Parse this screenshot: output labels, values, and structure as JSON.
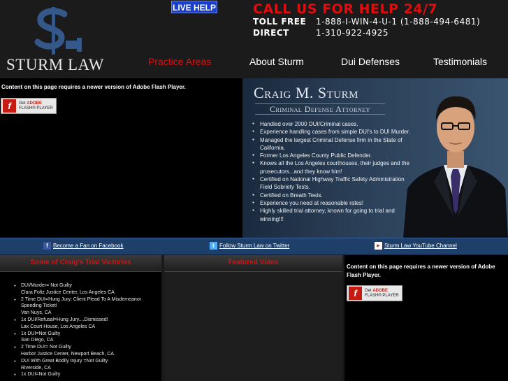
{
  "header": {
    "logo_text": "STURM LAW",
    "live_help": "LIVE HELP",
    "call_us": "CALL US FOR HELP 24/7",
    "toll_free_label": "TOLL FREE",
    "toll_free_number": "1-888-I-WIN-4-U-1 (1-888-494-6481)",
    "direct_label": "DIRECT",
    "direct_number": "1-310-922-4925"
  },
  "nav": {
    "items": [
      {
        "label": "Practice Areas",
        "active": true
      },
      {
        "label": "About Sturm",
        "active": false
      },
      {
        "label": "Dui Defenses",
        "active": false
      },
      {
        "label": "Testimonials",
        "active": false
      }
    ]
  },
  "hero": {
    "flash_message": "Content on this page requires a newer version of Adobe Flash Player.",
    "flash_badge": {
      "line1": "Get ",
      "brand": "ADOBE",
      "line2": "FLASH® PLAYER",
      "glyph": "f"
    },
    "name": "Craig M. Sturm",
    "title": "Criminal Defense Attorney",
    "bullets": [
      "Handled over 2000 DUI/Criminal cases.",
      "Experience handling cases from simple DUI's to DUI Murder.",
      "Managed the largest Criminal Defense firm in the State of California.",
      "Former Los Angeles County Public Defender.",
      "Knows all the Los Angeles courthouses, their judges and the prosecutors...and they know him!",
      "Certified on National Highway Traffic Safety Administration Field Sobriety Tests.",
      "Certified on Breath Tests.",
      "Experience you need at reasonable rates!",
      "Highly skilled trial attorney, known for going to trial and winning!!!"
    ]
  },
  "social": {
    "facebook": {
      "icon": "facebook-icon",
      "label": "Become a Fan on Facebook"
    },
    "twitter": {
      "icon": "twitter-icon",
      "label": "Follow Sturm Law on Twitter"
    },
    "youtube": {
      "icon": "youtube-icon",
      "label": "Sturm Law YouTube Channel"
    }
  },
  "columns": {
    "victories_title": "Some of Craig's Trial Victories",
    "video_title": "Featured Video",
    "flash_message": "Content on this page requires a newer version of Adobe Flash Player.",
    "victories": [
      {
        "title": "DUI/Murder= Not Guilty",
        "place": "Clara Foltz Justice Center, Los Angeles CA"
      },
      {
        "title": "2 Time DUI=Hung Jury: Client Plead To A Misdemeanor Speeding Ticket!",
        "place": "Van Nuys, CA"
      },
      {
        "title": "1x DUI/Refusal=Hung Jury....Dismissed!",
        "place": "Lax Court House, Los Angeles CA"
      },
      {
        "title": "1x DUI=Not Guilty",
        "place": "San Diego, CA"
      },
      {
        "title": "2 Time DUI= Not Guilty",
        "place": "Harbor Justice Center, Newport Beach, CA"
      },
      {
        "title": "DUI With Great Bodily Injury =Not Guilty",
        "place": "Riverside, CA"
      },
      {
        "title": "1x DUI=Not Guilty",
        "place": ""
      }
    ]
  },
  "colors": {
    "accent_red": "#e10d0d",
    "social_bar": "#1f3f6b",
    "live_help_blue": "#1a3fc9"
  }
}
